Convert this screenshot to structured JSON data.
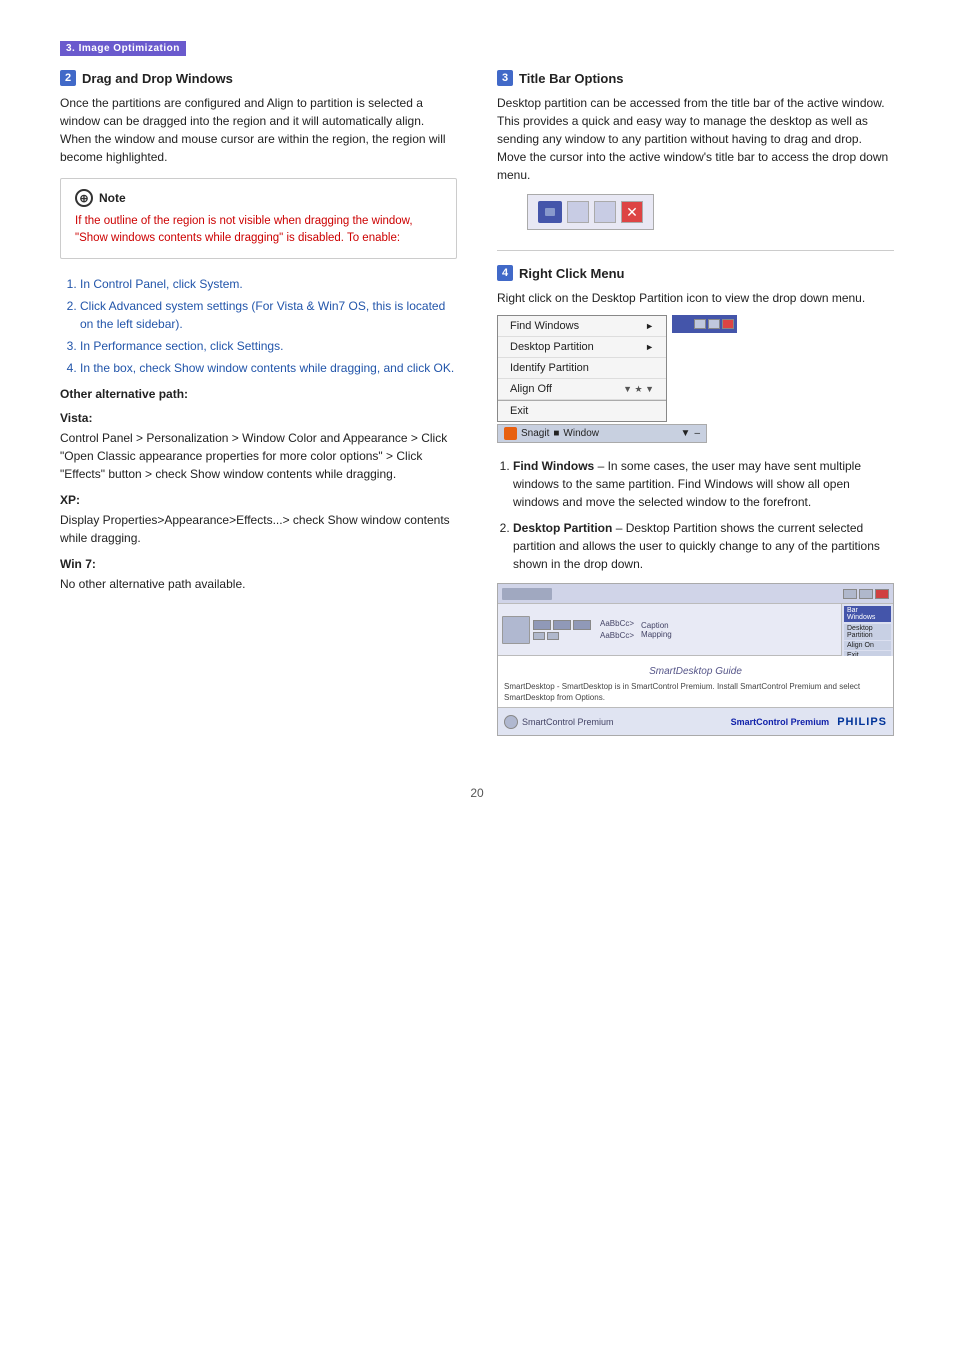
{
  "page": {
    "section_header": "3. Image Optimization",
    "page_number": "20"
  },
  "section2": {
    "badge": "2",
    "title": "Drag and Drop Windows",
    "para1": "Once the partitions are configured and Align to partition is selected a window can be dragged into the region and it will automatically align. When the window and mouse cursor are within the region, the region will become highlighted.",
    "note": {
      "title": "Note",
      "text": "If the outline of the region is not visible when dragging the window, \"Show windows contents while dragging\" is disabled.  To enable:"
    },
    "steps": [
      "In Control Panel, click System.",
      "Click Advanced system settings  (For Vista & Win7 OS, this is located on the left sidebar).",
      "In Performance section, click Settings.",
      "In the box, check Show window contents while dragging, and click OK."
    ],
    "alt_path_heading": "Other alternative path:",
    "vista_heading": "Vista:",
    "vista_text": "Control Panel > Personalization > Window Color and Appearance > Click \"Open Classic appearance properties for more color options\" > Click \"Effects\" button > check Show window contents while dragging.",
    "xp_heading": "XP:",
    "xp_text": "Display Properties>Appearance>Effects...> check Show window contents while dragging.",
    "win7_heading": "Win 7:",
    "win7_text": "No other alternative path available."
  },
  "section3": {
    "badge": "3",
    "title": "Title Bar Options",
    "para1": "Desktop partition can be accessed from the title bar of the active window. This provides a quick and easy way to manage the desktop as well as sending any window to any partition without having to drag and drop.  Move the cursor into the active window's title bar to access the drop down menu."
  },
  "section4": {
    "badge": "4",
    "title": "Right Click Menu",
    "para1": "Right click on the Desktop Partition icon to view the drop down menu.",
    "menu_items": [
      {
        "label": "Find Windows",
        "has_arrow": true
      },
      {
        "label": "Desktop Partition",
        "has_arrow": true
      },
      {
        "label": "Identify Partition",
        "has_arrow": false
      },
      {
        "label": "Align Off",
        "has_arrow": false
      },
      {
        "label": "Exit",
        "has_arrow": false
      }
    ],
    "item1_title": "Find Windows",
    "item1_text": "– In some cases, the user may have sent multiple windows to the same partition.  Find Windows will show all open windows and move the selected window to the forefront.",
    "item2_title": "Desktop Partition",
    "item2_text": "– Desktop Partition shows the current selected partition and allows the user to quickly change to any of the partitions shown in the drop down.",
    "smartdesktop_guide": "SmartDesktop Guide",
    "smartdesktop_desc": "SmartDesktop - SmartDesktop is in SmartControl Premium. Install SmartControl Premium and select SmartDesktop from Options.",
    "smartcontrol_label": "SmartControl Premium",
    "philips_logo": "PHILIPS"
  }
}
